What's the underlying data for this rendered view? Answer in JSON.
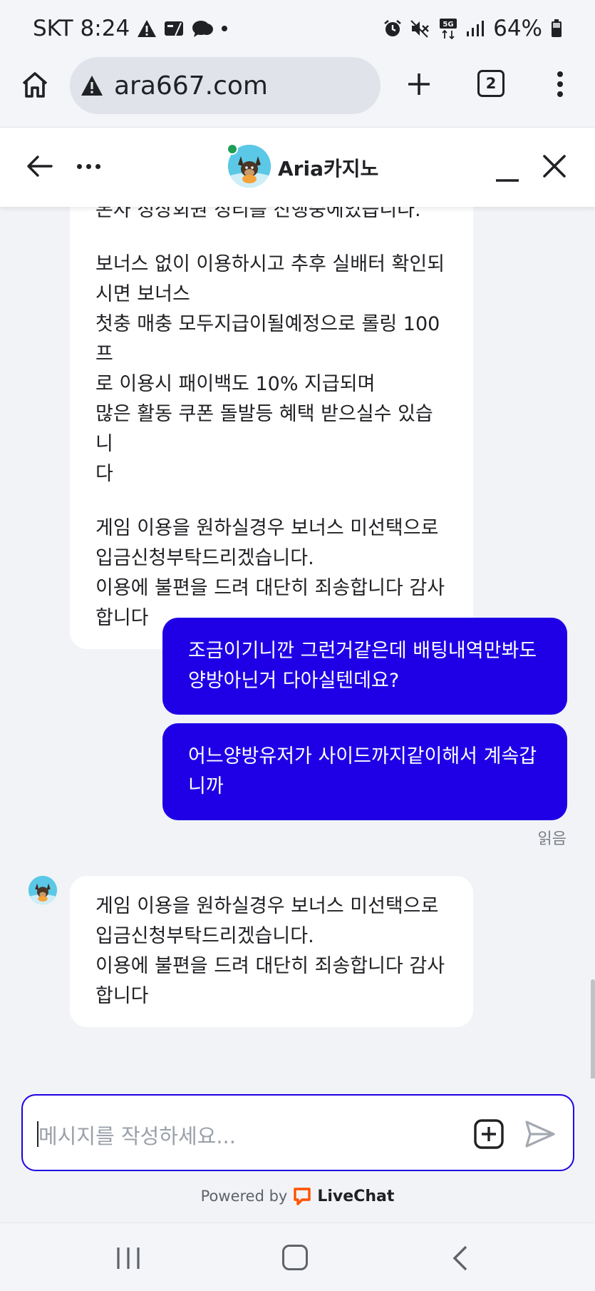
{
  "status_bar": {
    "carrier": "SKT",
    "time": "8:24",
    "battery": "64%",
    "network": "5G",
    "icons_left": [
      "warning-icon",
      "card-icon",
      "cloud-icon",
      "dot-icon"
    ],
    "icons_right": [
      "alarm-icon",
      "mute-icon",
      "data-icon",
      "signal-icon",
      "battery-icon"
    ]
  },
  "browser": {
    "url": "ara667.com",
    "tab_count": "2"
  },
  "chat_header": {
    "agent_name": "Aria카지노"
  },
  "messages": [
    {
      "from": "agent",
      "paragraphs": [
        "본사 정상회원 정리를 진행중에있습니다.",
        "보너스 없이 이용하시고 추후 실배터 확인되\n시면 보너스\n첫충 매충 모두지급이될예정으로 롤링 100프\n로 이용시 패이백도 10% 지급되며\n많은 활동 쿠폰 돌발등 혜택 받으실수 있습니\n다",
        "게임 이용을 원하실경우 보너스 미선택으로\n입금신청부탁드리겠습니다.\n이용에 불편을 드려 대단히 죄송합니다 감사\n합니다"
      ]
    },
    {
      "from": "visitor",
      "text": "조금이기니깐 그런거같은데 배팅내역만봐도\n양방아닌거 다아실텐데요?"
    },
    {
      "from": "visitor",
      "text": "어느양방유저가 사이드까지같이해서 계속갑\n니까"
    },
    {
      "from": "agent",
      "text": "게임 이용을 원하실경우 보너스 미선택으로\n입금신청부탁드리겠습니다.\n이용에 불편을 드려 대단히 죄송합니다 감사\n합니다"
    }
  ],
  "read_receipt": "읽음",
  "composer": {
    "placeholder": "메시지를 작성하세요..."
  },
  "footer": {
    "powered_by": "Powered by",
    "brand": "LiveChat"
  },
  "colors": {
    "accent": "#1f00e6",
    "online": "#1e9e54",
    "livechat_brand": "#ff5100"
  }
}
